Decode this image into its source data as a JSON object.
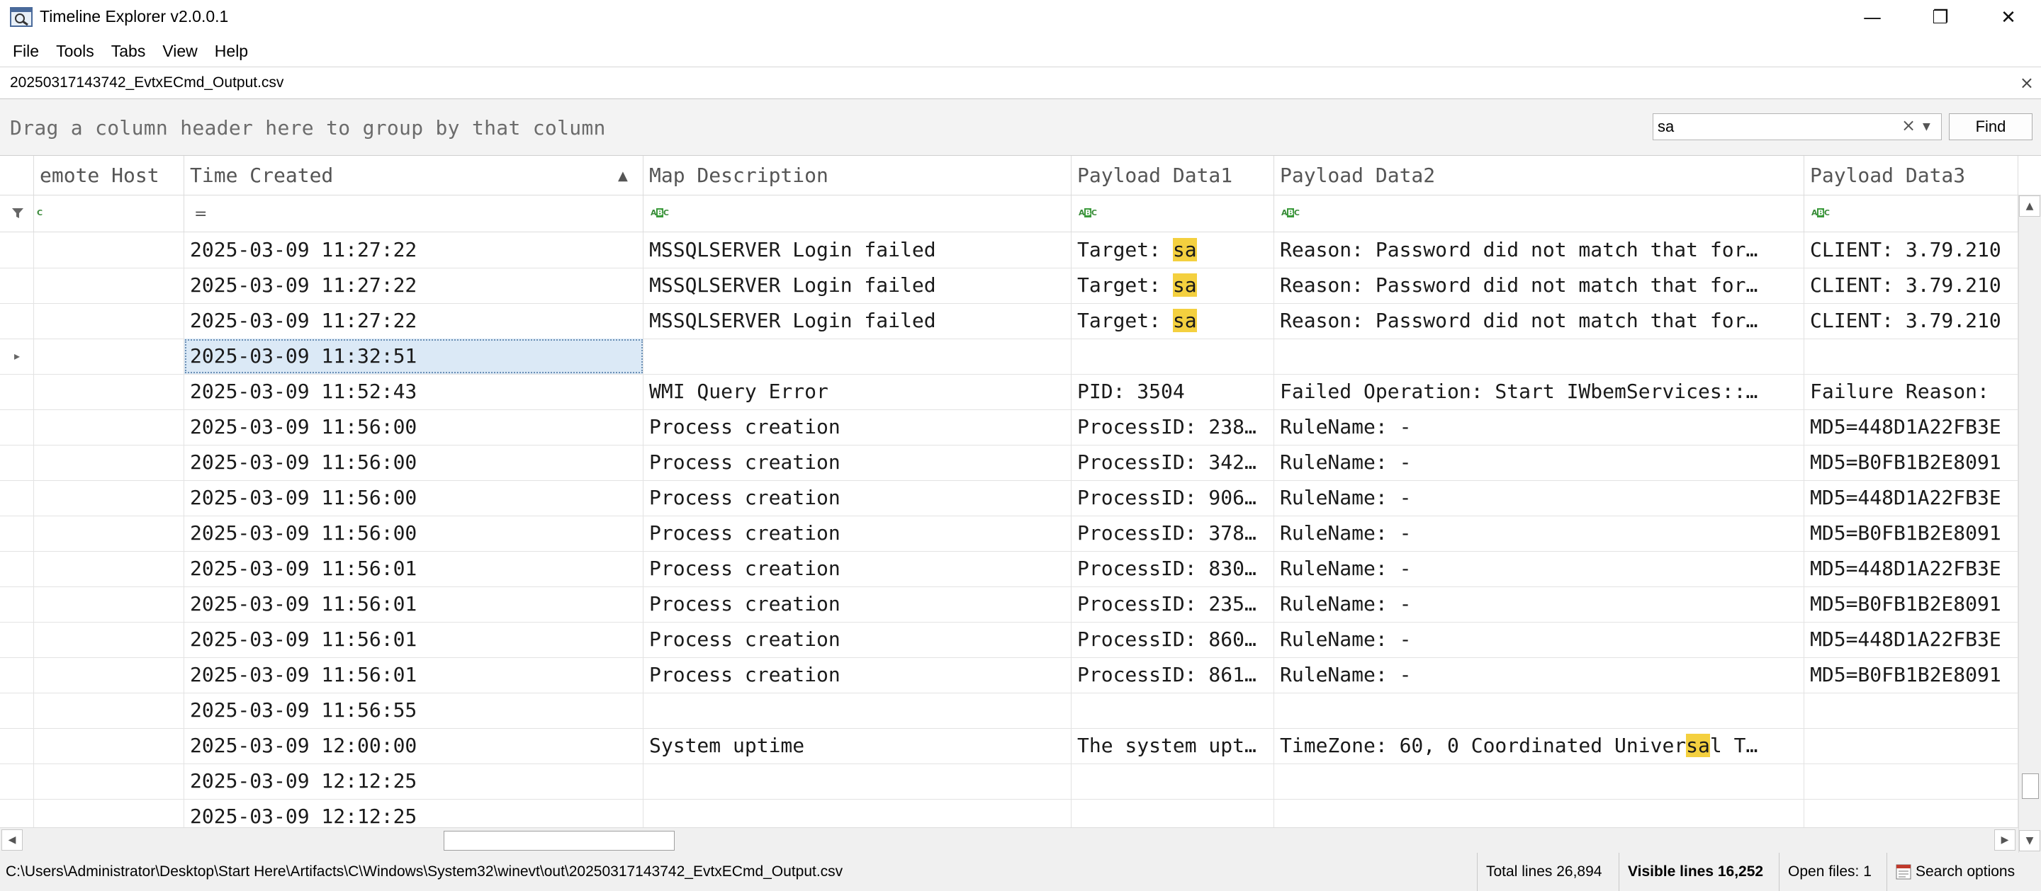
{
  "window": {
    "title": "Timeline Explorer v2.0.0.1",
    "minimize_glyph": "—",
    "restore_glyph": "❐",
    "close_glyph": "✕"
  },
  "menu": {
    "items": [
      "File",
      "Tools",
      "Tabs",
      "View",
      "Help"
    ]
  },
  "tab": {
    "label": "20250317143742_EvtxECmd_Output.csv",
    "close_glyph": "×"
  },
  "group_panel": {
    "text": "Drag a column header here to group by that column"
  },
  "search": {
    "value": "sa",
    "clear_glyph": "×",
    "dropdown_glyph": "▼",
    "find_label": "Find"
  },
  "columns": {
    "remote_host": "emote Host",
    "time_created": "Time Created",
    "map_description": "Map Description",
    "payload1": "Payload Data1",
    "payload2": "Payload Data2",
    "payload3": "Payload Data3"
  },
  "sort": {
    "column": "Time Created",
    "direction": "ascending",
    "glyph": "▲"
  },
  "filter_row": {
    "equals_glyph": "=",
    "abc_b": "A",
    "abc_mid": "B",
    "abc_c": "C"
  },
  "rows": [
    {
      "time": "2025-03-09 11:27:22",
      "map": "MSSQLSERVER Login failed",
      "p1": "Target: ",
      "p1_hl": "sa",
      "p1_post": "",
      "p2": "Reason: Password did not match that for…",
      "p2_hl": "",
      "p2_post": "",
      "p3": "CLIENT: 3.79.210"
    },
    {
      "time": "2025-03-09 11:27:22",
      "map": "MSSQLSERVER Login failed",
      "p1": "Target: ",
      "p1_hl": "sa",
      "p1_post": "",
      "p2": "Reason: Password did not match that for…",
      "p2_hl": "",
      "p2_post": "",
      "p3": "CLIENT: 3.79.210"
    },
    {
      "time": "2025-03-09 11:27:22",
      "map": "MSSQLSERVER Login failed",
      "p1": "Target: ",
      "p1_hl": "sa",
      "p1_post": "",
      "p2": "Reason: Password did not match that for…",
      "p2_hl": "",
      "p2_post": "",
      "p3": "CLIENT: 3.79.210"
    },
    {
      "time": "2025-03-09 11:32:51",
      "map": "",
      "p1": "",
      "p1_hl": "",
      "p1_post": "",
      "p2": "",
      "p2_hl": "",
      "p2_post": "",
      "p3": "",
      "selected": true
    },
    {
      "time": "2025-03-09 11:52:43",
      "map": "WMI Query Error",
      "p1": "PID: 3504",
      "p1_hl": "",
      "p1_post": "",
      "p2": "Failed Operation: Start IWbemServices::…",
      "p2_hl": "",
      "p2_post": "",
      "p3": "Failure Reason:"
    },
    {
      "time": "2025-03-09 11:56:00",
      "map": "Process creation",
      "p1": "ProcessID: 238…",
      "p1_hl": "",
      "p1_post": "",
      "p2": "RuleName: -",
      "p2_hl": "",
      "p2_post": "",
      "p3": "MD5=448D1A22FB3E"
    },
    {
      "time": "2025-03-09 11:56:00",
      "map": "Process creation",
      "p1": "ProcessID: 342…",
      "p1_hl": "",
      "p1_post": "",
      "p2": "RuleName: -",
      "p2_hl": "",
      "p2_post": "",
      "p3": "MD5=B0FB1B2E8091"
    },
    {
      "time": "2025-03-09 11:56:00",
      "map": "Process creation",
      "p1": "ProcessID: 906…",
      "p1_hl": "",
      "p1_post": "",
      "p2": "RuleName: -",
      "p2_hl": "",
      "p2_post": "",
      "p3": "MD5=448D1A22FB3E"
    },
    {
      "time": "2025-03-09 11:56:00",
      "map": "Process creation",
      "p1": "ProcessID: 378…",
      "p1_hl": "",
      "p1_post": "",
      "p2": "RuleName: -",
      "p2_hl": "",
      "p2_post": "",
      "p3": "MD5=B0FB1B2E8091"
    },
    {
      "time": "2025-03-09 11:56:01",
      "map": "Process creation",
      "p1": "ProcessID: 830…",
      "p1_hl": "",
      "p1_post": "",
      "p2": "RuleName: -",
      "p2_hl": "",
      "p2_post": "",
      "p3": "MD5=448D1A22FB3E"
    },
    {
      "time": "2025-03-09 11:56:01",
      "map": "Process creation",
      "p1": "ProcessID: 235…",
      "p1_hl": "",
      "p1_post": "",
      "p2": "RuleName: -",
      "p2_hl": "",
      "p2_post": "",
      "p3": "MD5=B0FB1B2E8091"
    },
    {
      "time": "2025-03-09 11:56:01",
      "map": "Process creation",
      "p1": "ProcessID: 860…",
      "p1_hl": "",
      "p1_post": "",
      "p2": "RuleName: -",
      "p2_hl": "",
      "p2_post": "",
      "p3": "MD5=448D1A22FB3E"
    },
    {
      "time": "2025-03-09 11:56:01",
      "map": "Process creation",
      "p1": "ProcessID: 861…",
      "p1_hl": "",
      "p1_post": "",
      "p2": "RuleName: -",
      "p2_hl": "",
      "p2_post": "",
      "p3": "MD5=B0FB1B2E8091"
    },
    {
      "time": "2025-03-09 11:56:55",
      "map": "",
      "p1": "",
      "p1_hl": "",
      "p1_post": "",
      "p2": "",
      "p2_hl": "",
      "p2_post": "",
      "p3": ""
    },
    {
      "time": "2025-03-09 12:00:00",
      "map": "System uptime",
      "p1": "The system upt…",
      "p1_hl": "",
      "p1_post": "",
      "p2": "TimeZone: 60, 0 Coordinated Univer",
      "p2_hl": "sa",
      "p2_post": "l T…",
      "p3": ""
    },
    {
      "time": "2025-03-09 12:12:25",
      "map": "",
      "p1": "",
      "p1_hl": "",
      "p1_post": "",
      "p2": "",
      "p2_hl": "",
      "p2_post": "",
      "p3": ""
    },
    {
      "time": "2025-03-09 12:12:25",
      "map": "",
      "p1": "",
      "p1_hl": "",
      "p1_post": "",
      "p2": "",
      "p2_hl": "",
      "p2_post": "",
      "p3": ""
    }
  ],
  "row_indicator_glyph": "▸",
  "scroll": {
    "up": "▲",
    "down": "▼",
    "left": "◀",
    "right": "▶"
  },
  "status": {
    "path": "C:\\Users\\Administrator\\Desktop\\Start Here\\Artifacts\\C\\Windows\\System32\\winevt\\out\\20250317143742_EvtxECmd_Output.csv",
    "total_lines": "Total lines 26,894",
    "visible_lines": "Visible lines 16,252",
    "open_files": "Open files: 1",
    "search_options": "Search options"
  },
  "colors": {
    "highlight": "#f4d03f",
    "selection": "#dbe9f6",
    "abc_green": "#3a9a3a"
  },
  "icons": [
    "app-icon",
    "filter-icon",
    "equals-icon",
    "abc-filter-icon",
    "search-options-icon"
  ]
}
